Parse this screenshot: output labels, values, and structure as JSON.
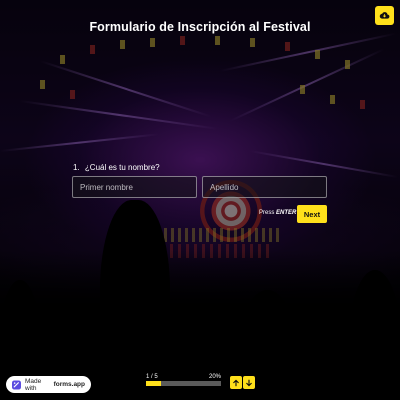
{
  "form": {
    "title": "Formulario de Inscripción al Festival"
  },
  "question": {
    "number": "1.",
    "text": "¿Cuál es tu nombre?",
    "first_name_placeholder": "Primer nombre",
    "first_name_value": "",
    "last_name_placeholder": "Apellido",
    "last_name_value": ""
  },
  "actions": {
    "press_text": "Press",
    "enter_key": "ENTER",
    "next_label": "Next"
  },
  "footer": {
    "made_with": "Made with",
    "brand": "forms.app",
    "step": "1 / 5",
    "percent": "20%",
    "progress": 0.2
  },
  "icons": {
    "top_right": "cloud-save-icon",
    "up": "arrow-up-icon",
    "down": "arrow-down-icon",
    "logo": "forms-app-logo-icon"
  },
  "colors": {
    "accent": "#ffe01b",
    "background": "#050208"
  }
}
